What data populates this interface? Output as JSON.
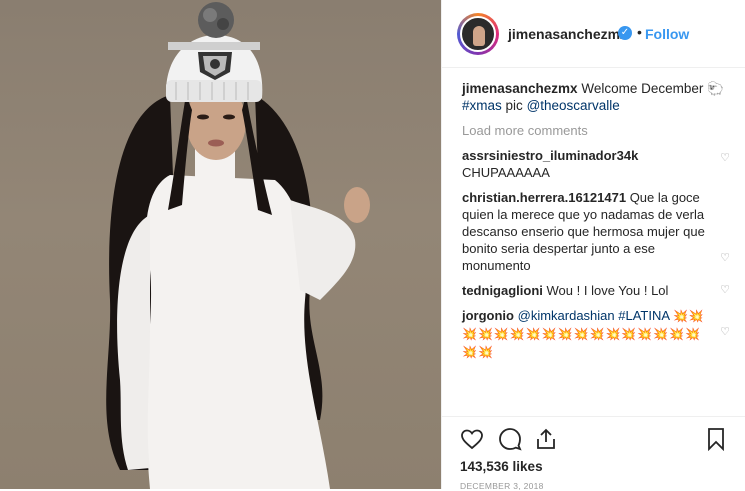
{
  "header": {
    "username": "jimenasanchezmx",
    "verified_icon": "verified-badge-icon",
    "separator": "•",
    "follow_label": "Follow"
  },
  "caption": {
    "username": "jimenasanchezmx",
    "text": "Welcome December 🐑",
    "hashtag": "#xmas",
    "text2": "pic",
    "mention": "@theoscarvalle"
  },
  "load_more": "Load more comments",
  "comments": [
    {
      "username": "assrsiniestro_iluminador34k",
      "text": "CHUPAAAAAA"
    },
    {
      "username": "christian.herrera.16121471",
      "text": "Que la goce quien la merece que yo nadamas de verla descanso enserio que hermosa mujer que bonito seria despertar junto a ese monumento"
    },
    {
      "username": "tednigaglioni",
      "text": "Wou ! I love You ! Lol"
    },
    {
      "username": "jorgonio",
      "mention": "@kimkardashian",
      "hashtag": "#LATINA",
      "emojis": "💥💥💥💥💥💥💥💥💥💥💥💥💥💥💥💥💥💥💥"
    }
  ],
  "actions": {
    "like_icon": "heart-icon",
    "comment_icon": "comment-icon",
    "share_icon": "share-icon",
    "save_icon": "bookmark-icon"
  },
  "likes": "143,536 likes",
  "date": "DECEMBER 3, 2018",
  "colors": {
    "accent": "#3897f0",
    "text": "#262626",
    "muted": "#999999",
    "link": "#003569",
    "photo_background": "#8d806f"
  }
}
